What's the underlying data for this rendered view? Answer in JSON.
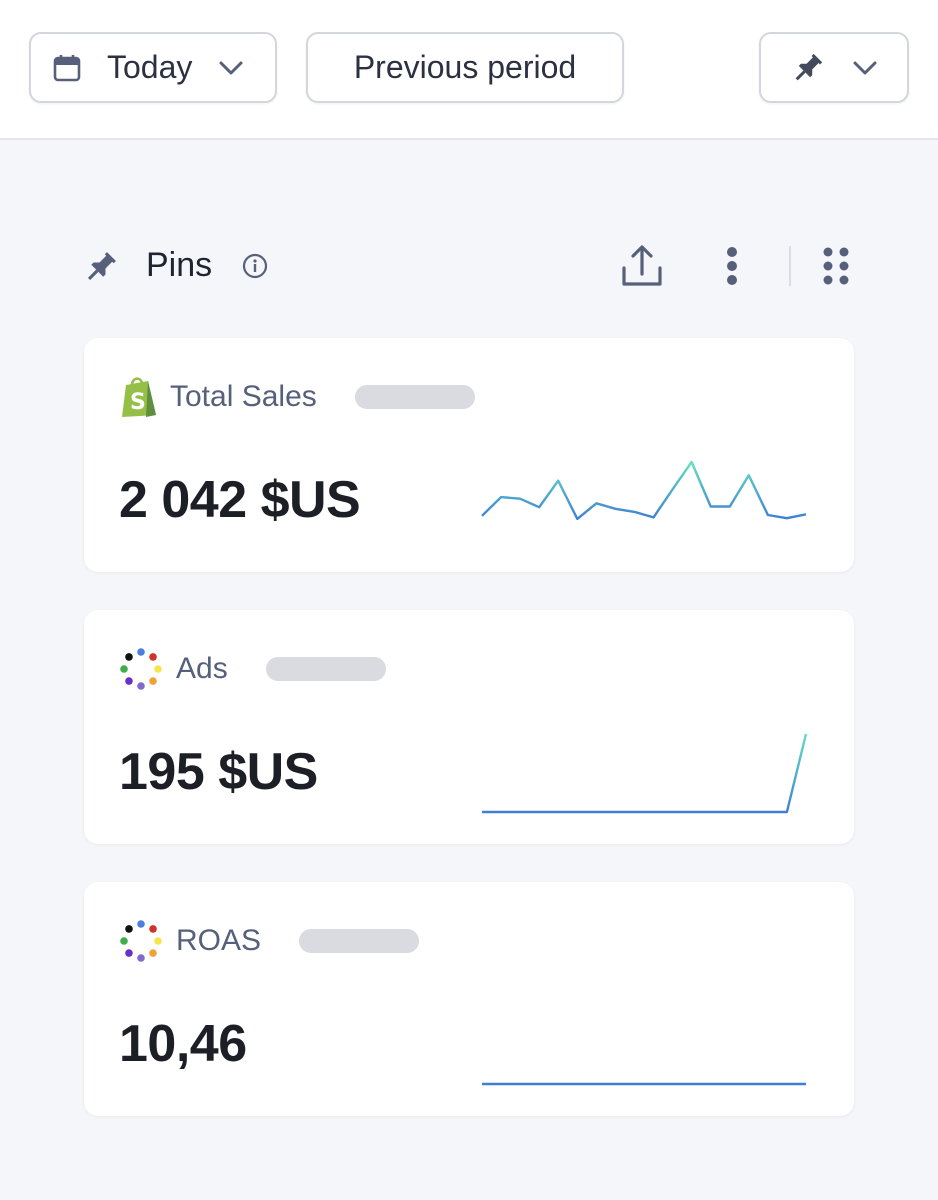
{
  "toolbar": {
    "date_label": "Today",
    "compare_label": "Previous period",
    "icons": [
      "calendar-icon",
      "chevron-down-icon",
      "pin-icon",
      "chevron-down-icon"
    ]
  },
  "pins": {
    "title": "Pins",
    "icons": [
      "pin-icon",
      "info-icon",
      "share-icon",
      "more-vertical-icon",
      "drag-grid-icon"
    ]
  },
  "cards": [
    {
      "name": "Total Sales",
      "value": "2 042 $US",
      "source_icon": "shopify-icon",
      "sparkline": [
        0.31,
        0.55,
        0.53,
        0.42,
        0.76,
        0.27,
        0.47,
        0.4,
        0.36,
        0.29,
        0.65,
        1.0,
        0.43,
        0.43,
        0.83,
        0.32,
        0.28,
        0.33
      ]
    },
    {
      "name": "Ads",
      "value": "195 $US",
      "source_icon": "ads-dots-icon",
      "sparkline": [
        0,
        0,
        0,
        0,
        0,
        0,
        0,
        0,
        0,
        0,
        0,
        0,
        0,
        0,
        0,
        0,
        0,
        1
      ]
    },
    {
      "name": "ROAS",
      "value": "10,46",
      "source_icon": "ads-dots-icon",
      "sparkline": [
        0,
        0,
        0,
        0,
        0,
        0,
        0,
        0,
        0,
        0,
        0,
        0,
        0,
        0,
        0,
        0,
        0,
        0
      ]
    }
  ],
  "colors": {
    "spark_start": "#3f7fd6",
    "spark_end": "#63e0c0",
    "ads_dots": [
      "#4a7fe0",
      "#d2322d",
      "#f7e64a",
      "#f2a134",
      "#7f6bd0",
      "#6a2fc9",
      "#3fae49",
      "#111111"
    ]
  }
}
